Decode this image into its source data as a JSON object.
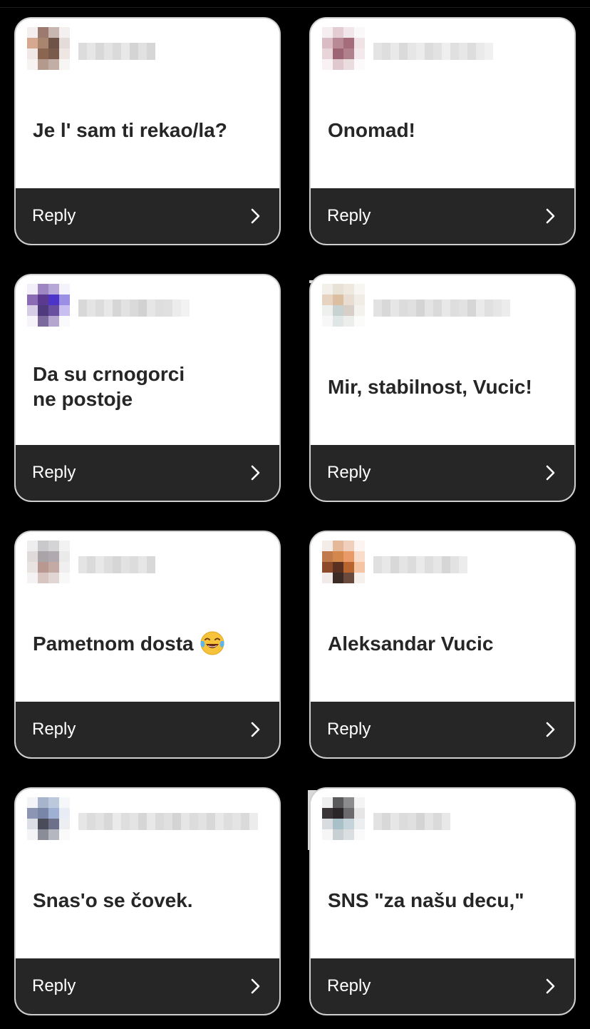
{
  "colors": {
    "page_background": "#000000",
    "card_background": "#ffffff",
    "card_border": "#cfcfcf",
    "reply_bar": "#262626",
    "message_text": "#262626",
    "reply_text": "#ffffff"
  },
  "reply_label": "Reply",
  "cards": [
    {
      "message": "Je l' sam ti rekao/la?",
      "avatar_pixels": [
        "#f4eeee",
        "#9c7a70",
        "#c8b6b0",
        "#f4f0f0",
        "#d6a88f",
        "#a7856f",
        "#6e5346",
        "#e4dcd8",
        "#f0e8e6",
        "#8a6651",
        "#7a5a4a",
        "#ede6e3",
        "#f6f3f2",
        "#b39a8d",
        "#c2aea5",
        "#f8f6f5"
      ],
      "username_pixels": [
        "#dcdcdc",
        "#e6e6e6",
        "#d8d8d8",
        "#e3e3e3",
        "#dadada",
        "#e8e8e8",
        "#d4d4d4",
        "#e1e1e1",
        "#d6d6d6"
      ]
    },
    {
      "message": "Onomad!",
      "avatar_pixels": [
        "#f4eef0",
        "#e3cdd3",
        "#f1e7ea",
        "#fbf8f9",
        "#d9bcc4",
        "#b98a96",
        "#a56d7c",
        "#efe3e6",
        "#e8d5da",
        "#9c6474",
        "#b0808c",
        "#f3e9ec",
        "#f8f2f4",
        "#e0c8cf",
        "#ebdce0",
        "#fcfafb"
      ],
      "username_pixels": [
        "#e4e4e4",
        "#dedede",
        "#e9e9e9",
        "#dadada",
        "#e6e6e6",
        "#ececec",
        "#dcdcdc",
        "#e2e2e2",
        "#efefef",
        "#e0e0e0",
        "#e7e7e7",
        "#dddddd",
        "#eaeaea",
        "#f0f0f0"
      ]
    },
    {
      "message": "Da su crnogorci\nne postoje",
      "avatar_pixels": [
        "#f2eff8",
        "#9d86c2",
        "#b7a6d8",
        "#f4f2fa",
        "#8b6bb3",
        "#5a3b8f",
        "#4d34c9",
        "#9a8fe4",
        "#d6cce6",
        "#4f3a7e",
        "#6a4fa0",
        "#c8bff0",
        "#f6f4fa",
        "#7c6a9e",
        "#b4a6cf",
        "#faf9fc"
      ],
      "username_pixels": [
        "#d8d8d8",
        "#e4e4e4",
        "#dcdcdc",
        "#e8e8e8",
        "#d6d6d6",
        "#e2e2e2",
        "#dadada",
        "#d2d2d2",
        "#e6e6e6",
        "#dedede",
        "#e0e0e0",
        "#ececec",
        "#f2f2f2"
      ]
    },
    {
      "message": "Mir, stabilnost, Vucic!",
      "avatar_pixels": [
        "#f3f0ea",
        "#e8e2d6",
        "#eee8df",
        "#f8f6f2",
        "#e6d4c0",
        "#dcbfa0",
        "#e8ddd0",
        "#f0ece6",
        "#eef0ee",
        "#c8d2d0",
        "#d8d0c8",
        "#f4f2ee",
        "#f6f7f6",
        "#dfe6e5",
        "#eceeec",
        "#fbfbfa"
      ],
      "username_pixels": [
        "#e2e2e2",
        "#d8d8d8",
        "#e6e6e6",
        "#dcdcdc",
        "#e0e0e0",
        "#d4d4d4",
        "#e4e4e4",
        "#dadada",
        "#e8e8e8",
        "#dedede",
        "#e2e2e2",
        "#d6d6d6",
        "#eaeaea",
        "#e0e0e0",
        "#e6e6e6",
        "#ececec"
      ]
    },
    {
      "message": "Pametnom dosta",
      "emoji": "face-with-tears-of-joy",
      "avatar_pixels": [
        "#eeeeee",
        "#c9c9cb",
        "#d4d4d6",
        "#f2f2f2",
        "#e0dada",
        "#a8a4a8",
        "#b0aab0",
        "#eaeaea",
        "#e8e2e0",
        "#b89890",
        "#c4aaa4",
        "#efefef",
        "#f4f2f2",
        "#d8c4c0",
        "#e2d6d4",
        "#f8f8f8"
      ],
      "username_pixels": [
        "#e4e4e4",
        "#dadada",
        "#e8e8e8",
        "#dedede",
        "#d6d6d6",
        "#e2e2e2",
        "#dcdcdc",
        "#e6e6e6",
        "#d8d8d8"
      ]
    },
    {
      "message": "Aleksandar Vucic",
      "avatar_pixels": [
        "#f4ece6",
        "#e6b89a",
        "#f0d0bc",
        "#fbf4f0",
        "#c07a4c",
        "#d4874a",
        "#ea9a66",
        "#f8dccc",
        "#8c4a2a",
        "#5a3020",
        "#b8642e",
        "#f4c4a4",
        "#f0ebe8",
        "#3c2a24",
        "#6a4a3c",
        "#f6f0ec"
      ],
      "username_pixels": [
        "#e0e0e0",
        "#e8e8e8",
        "#d8d8d8",
        "#e4e4e4",
        "#dcdcdc",
        "#eaeaea",
        "#dedede",
        "#e6e6e6",
        "#d6d6d6",
        "#e2e2e2",
        "#ececec"
      ]
    },
    {
      "message": "Snas'o se čovek.",
      "avatar_pixels": [
        "#f2f4f8",
        "#a8b4cc",
        "#bcc8dc",
        "#f6f7fa",
        "#8c96b4",
        "#7a86a8",
        "#9eb0d4",
        "#e8ecf4",
        "#dcdee6",
        "#4a4c5a",
        "#6c7088",
        "#eceef2",
        "#f4f4f6",
        "#8a8c98",
        "#b4b6c0",
        "#fafafb"
      ],
      "username_pixels": [
        "#e6e6e6",
        "#dcdcdc",
        "#e2e2e2",
        "#d8d8d8",
        "#eaeaea",
        "#dedede",
        "#e4e4e4",
        "#d6d6d6",
        "#e8e8e8",
        "#dadada",
        "#e0e0e0",
        "#d4d4d4",
        "#e6e6e6",
        "#dcdcdc",
        "#e2e2e2",
        "#d8d8d8",
        "#e8e8e8",
        "#dedede",
        "#e4e4e4",
        "#dadada",
        "#ececec"
      ]
    },
    {
      "message": "SNS \"za našu decu,\"",
      "avatar_pixels": [
        "#eeeeee",
        "#5a5a5c",
        "#8c8c8e",
        "#f4f4f4",
        "#3a3638",
        "#2a2628",
        "#6c6a6c",
        "#e6e6e6",
        "#d8dcde",
        "#a8c0c8",
        "#c4d4da",
        "#eceeef",
        "#f6f6f6",
        "#c8d0d4",
        "#dcdfe1",
        "#fafafa"
      ],
      "username_pixels": [
        "#e2e2e2",
        "#d8d8d8",
        "#e6e6e6",
        "#dcdcdc",
        "#e0e0e0",
        "#d4d4d4",
        "#e4e4e4",
        "#dadada",
        "#e8e8e8"
      ]
    }
  ]
}
